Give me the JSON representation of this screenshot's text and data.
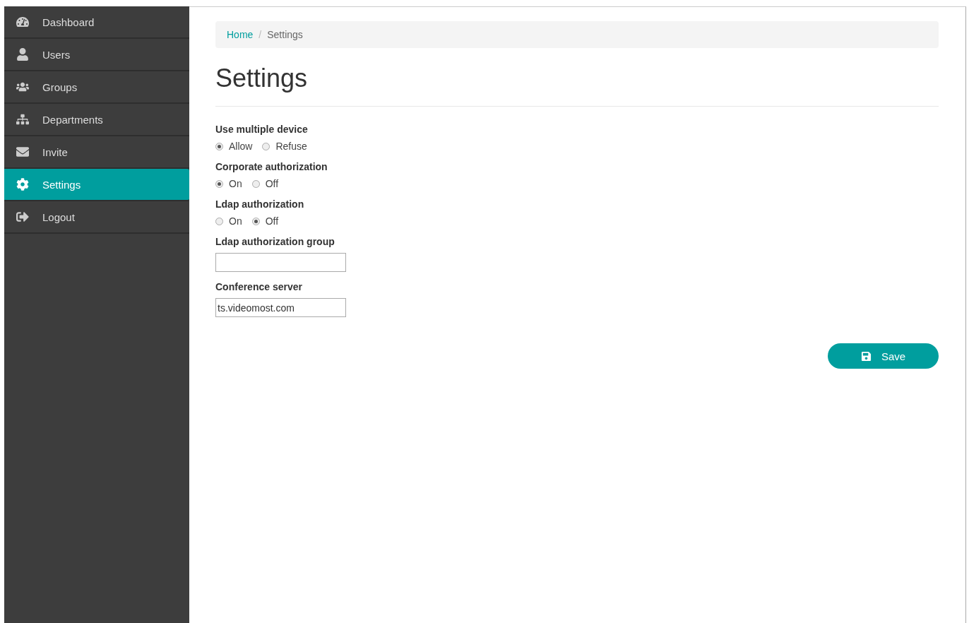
{
  "sidebar": {
    "items": [
      {
        "label": "Dashboard",
        "selected": false
      },
      {
        "label": "Users",
        "selected": false
      },
      {
        "label": "Groups",
        "selected": false
      },
      {
        "label": "Departments",
        "selected": false
      },
      {
        "label": "Invite",
        "selected": false
      },
      {
        "label": "Settings",
        "selected": true
      },
      {
        "label": "Logout",
        "selected": false
      }
    ]
  },
  "breadcrumb": [
    {
      "label": "Home",
      "kind": "link"
    },
    {
      "label": "Settings",
      "kind": "current"
    }
  ],
  "breadcrumb_separator": "/",
  "page_title": "Settings",
  "fields": [
    {
      "kind": "radio",
      "label": "Use multiple device",
      "options": [
        {
          "label": "Allow",
          "selected": true
        },
        {
          "label": "Refuse",
          "selected": false
        }
      ]
    },
    {
      "kind": "radio",
      "label": "Corporate authorization",
      "options": [
        {
          "label": "On",
          "selected": true
        },
        {
          "label": "Off",
          "selected": false
        }
      ]
    },
    {
      "kind": "radio",
      "label": "Ldap authorization",
      "options": [
        {
          "label": "On",
          "selected": false
        },
        {
          "label": "Off",
          "selected": true
        }
      ]
    },
    {
      "kind": "text",
      "label": "Ldap authorization group"
    },
    {
      "kind": "text",
      "label": "Conference server",
      "value": "ts.videomost.com"
    }
  ],
  "save_button": {
    "label": "Save"
  }
}
